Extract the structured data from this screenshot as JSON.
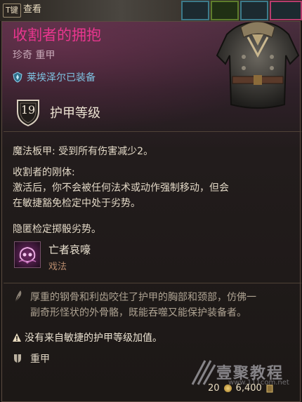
{
  "topbar": {
    "key_label": "T键",
    "inspect_label": "查看"
  },
  "item": {
    "name": "收割者的拥抱",
    "rarity_type": "珍奇 重甲",
    "equipped_by": "莱埃泽尔已装备",
    "armor_class_value": "19",
    "armor_class_label": "护甲等级"
  },
  "effects": {
    "line1": "魔法板甲: 受到所有伤害减少2。",
    "reaper_title": "收割者的刚体:",
    "reaper_line1": "激活后，你不会被任何法术或动作强制移动，但会",
    "reaper_line2": "在敏捷豁免检定中处于劣势。",
    "stealth": "隐匿检定掷骰劣势。"
  },
  "spell": {
    "name": "亡者哀嚎",
    "type": "戏法"
  },
  "flavor": {
    "line1": "厚重的钢骨和利齿咬住了护甲的胸部和颈部，仿佛一",
    "line2": "副奇形怪状的外骨骼，既能吞噬又能保护装备者。"
  },
  "notes": {
    "no_dex": "没有来自敏捷的护甲等级加值。",
    "armor_type": "重甲"
  },
  "stats": {
    "weight": "20",
    "value": "6,400"
  },
  "watermark": {
    "main": "壹聚教程",
    "sub": "www.111com.net"
  },
  "colors": {
    "rarity_accent": "#e8368e",
    "equipped_text": "#7ec3e2"
  },
  "icons": {
    "equipped": "shield-emblem-icon",
    "armor_class": "shield-icon",
    "spell": "necrotic-skull-icon",
    "flavor": "quill-icon",
    "warning": "warning-icon",
    "armor_type": "heavy-armor-icon",
    "value": "gold-coin-icon"
  }
}
